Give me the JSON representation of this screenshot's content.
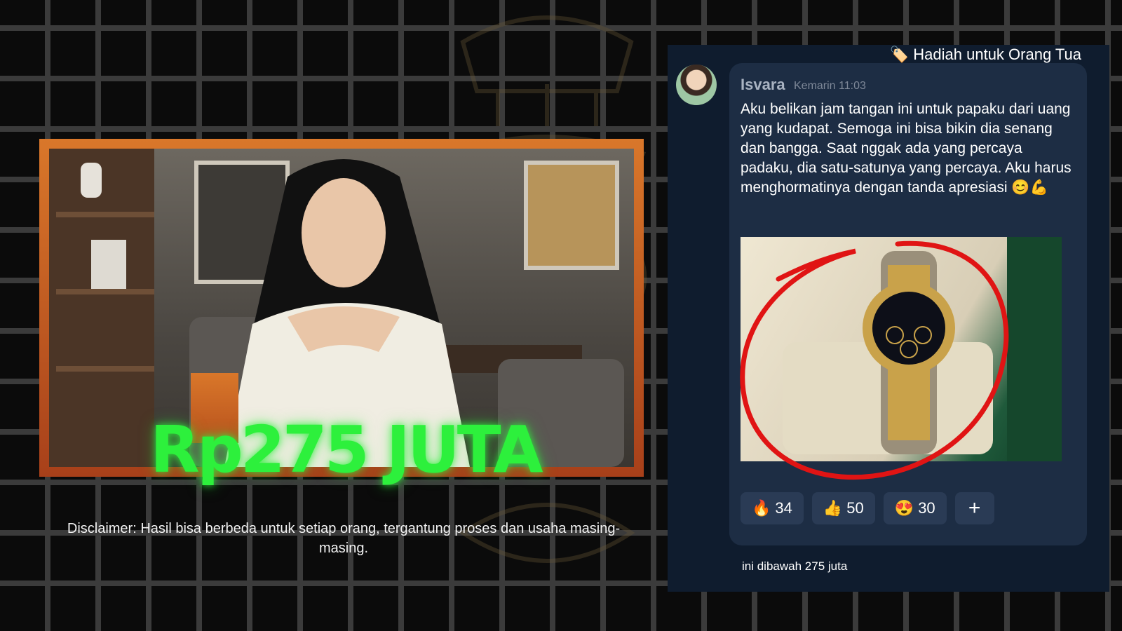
{
  "left_card": {
    "price": "Rp275 JUTA",
    "disclaimer": "Disclaimer: Hasil bisa berbeda untuk setiap orang, tergantung proses dan usaha masing-masing."
  },
  "chat": {
    "tag_icon": "🏷️",
    "tag": "Hadiah untuk Orang Tua",
    "sender": "Isvara",
    "time": "Kemarin 11:03",
    "message": "Aku belikan jam tangan ini untuk papaku dari uang yang kudapat. Semoga ini bisa bikin dia senang dan bangga. Saat nggak ada yang percaya padaku, dia satu-satunya yang percaya. Aku harus menghormatinya dengan tanda apresiasi 😊💪",
    "reactions": [
      {
        "emoji": "🔥",
        "count": "34"
      },
      {
        "emoji": "👍",
        "count": "50"
      },
      {
        "emoji": "😍",
        "count": "30"
      }
    ],
    "add_reaction": "+",
    "caption": "ini dibawah 275 juta"
  },
  "colors": {
    "frame": "#d9772a",
    "price_green": "#2df03c",
    "chat_bg": "#0f1c2e",
    "bubble_bg": "#1d2d44",
    "highlight_red": "#e01414"
  }
}
